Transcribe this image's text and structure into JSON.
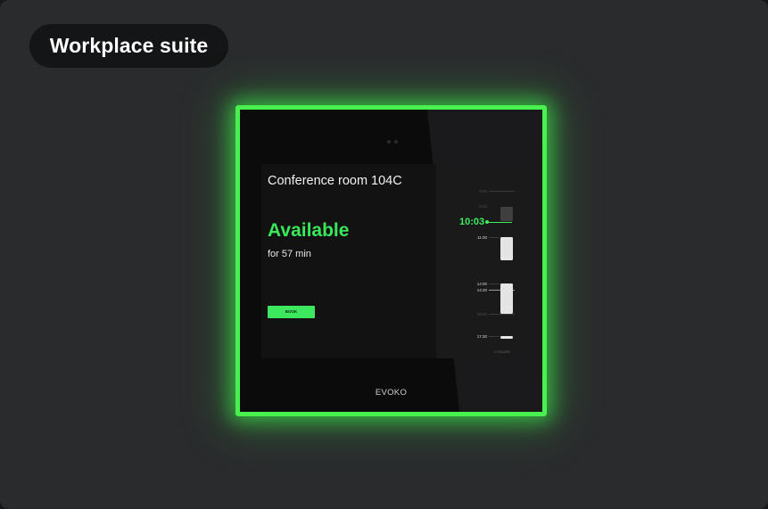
{
  "header": {
    "title": "Workplace suite"
  },
  "device": {
    "brand": "EVOKO",
    "accent_color": "#49f14f"
  },
  "room": {
    "name": "Conference room 104C",
    "status": "Available",
    "duration": "for 57 min",
    "book_label": "BOOK"
  },
  "timeline": {
    "current_time": "10:03",
    "hours_label": "1 HOURS",
    "labels": [
      "9:00",
      "9:00",
      "11:00",
      "14:00",
      "14:20",
      "16:00",
      "17:30"
    ]
  },
  "colors": {
    "status_green": "#39e85a",
    "background": "#2a2b2d"
  }
}
